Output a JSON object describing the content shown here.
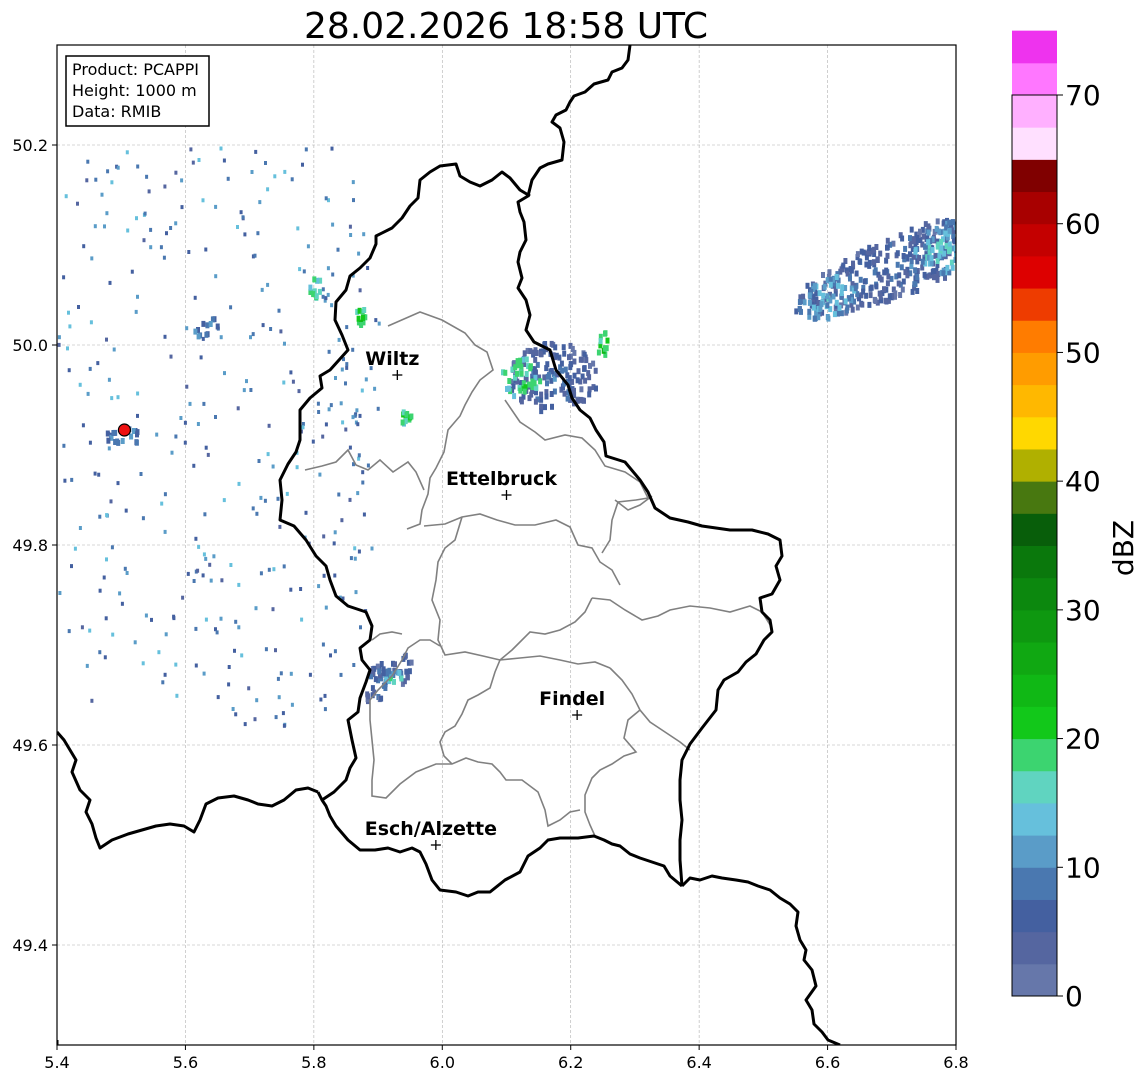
{
  "title": "28.02.2026 18:58 UTC",
  "info_box": {
    "line1": "Product: PCAPPI",
    "line2": "Height: 1000 m",
    "line3": "Data: RMIB"
  },
  "colorbar": {
    "label": "dBZ",
    "min": 0,
    "max": 70,
    "tick_values": [
      0,
      10,
      20,
      30,
      40,
      50,
      60,
      70
    ],
    "tick_labels": [
      "0",
      "10",
      "20",
      "30",
      "40",
      "50",
      "60",
      "70"
    ],
    "step": 2.5,
    "colors": [
      "#6677aa",
      "#5566a0",
      "#4460a0",
      "#4a78b0",
      "#5a9cc8",
      "#66c0dc",
      "#60d4c0",
      "#3cd470",
      "#12c81a",
      "#10b815",
      "#10a812",
      "#0e9810",
      "#0c880e",
      "#0a780c",
      "#085e0a",
      "#487810",
      "#b0b000",
      "#ffd800",
      "#ffb800",
      "#ff9c00",
      "#ff7c00",
      "#ee3c00",
      "#dd0000",
      "#c40000",
      "#a80000",
      "#800000",
      "#ffe0ff",
      "#ffb0ff",
      "#ff77ff",
      "#ee33ee"
    ]
  },
  "axes": {
    "x_ticks": [
      "5.4",
      "5.6",
      "5.8",
      "6.0",
      "6.2",
      "6.4",
      "6.6",
      "6.8"
    ],
    "x_values": [
      5.4,
      5.6,
      5.8,
      6.0,
      6.2,
      6.4,
      6.6,
      6.8
    ],
    "y_ticks": [
      "49.4",
      "49.6",
      "49.8",
      "50.0",
      "50.2"
    ],
    "y_values": [
      49.4,
      49.6,
      49.8,
      50.0,
      50.2
    ],
    "lon_range": [
      5.4,
      6.8
    ],
    "lat_range": [
      49.3,
      50.3
    ],
    "grid": true
  },
  "cities": [
    {
      "name": "Wiltz",
      "lon": 5.93,
      "lat": 49.97
    },
    {
      "name": "Ettelbruck",
      "lon": 6.1,
      "lat": 49.85
    },
    {
      "name": "Findel",
      "lon": 6.21,
      "lat": 49.63
    },
    {
      "name": "Esch/Alzette",
      "lon": 5.99,
      "lat": 49.5
    }
  ],
  "radar_site": {
    "lon": 5.505,
    "lat": 49.915,
    "color": "#ee1111"
  },
  "echoes": [
    {
      "lon": 6.72,
      "lat": 50.085,
      "rlon": 0.19,
      "rlat": 0.03,
      "angle": -22,
      "dbz": 8
    },
    {
      "lon": 6.78,
      "lat": 50.1,
      "rlon": 0.05,
      "rlat": 0.025,
      "angle": -22,
      "dbz": 15
    },
    {
      "lon": 6.6,
      "lat": 50.05,
      "rlon": 0.05,
      "rlat": 0.02,
      "angle": -22,
      "dbz": 14
    },
    {
      "lon": 6.17,
      "lat": 49.97,
      "rlon": 0.07,
      "rlat": 0.035,
      "angle": 0,
      "dbz": 8
    },
    {
      "lon": 6.12,
      "lat": 49.97,
      "rlon": 0.03,
      "rlat": 0.02,
      "angle": 0,
      "dbz": 20
    },
    {
      "lon": 6.25,
      "lat": 50.0,
      "rlon": 0.01,
      "rlat": 0.015,
      "angle": 0,
      "dbz": 22
    },
    {
      "lon": 5.91,
      "lat": 49.67,
      "rlon": 0.05,
      "rlat": 0.016,
      "angle": -40,
      "dbz": 8
    },
    {
      "lon": 5.92,
      "lat": 49.67,
      "rlon": 0.015,
      "rlat": 0.008,
      "angle": -40,
      "dbz": 16
    },
    {
      "lon": 5.8,
      "lat": 50.06,
      "rlon": 0.01,
      "rlat": 0.01,
      "angle": 0,
      "dbz": 20
    },
    {
      "lon": 5.87,
      "lat": 50.03,
      "rlon": 0.01,
      "rlat": 0.01,
      "angle": 0,
      "dbz": 22
    },
    {
      "lon": 5.94,
      "lat": 49.93,
      "rlon": 0.01,
      "rlat": 0.006,
      "angle": 0,
      "dbz": 20
    },
    {
      "lon": 5.63,
      "lat": 50.02,
      "rlon": 0.025,
      "rlat": 0.006,
      "angle": -30,
      "dbz": 12
    },
    {
      "lon": 5.5,
      "lat": 49.91,
      "rlon": 0.03,
      "rlat": 0.01,
      "angle": 0,
      "dbz": 12
    }
  ]
}
